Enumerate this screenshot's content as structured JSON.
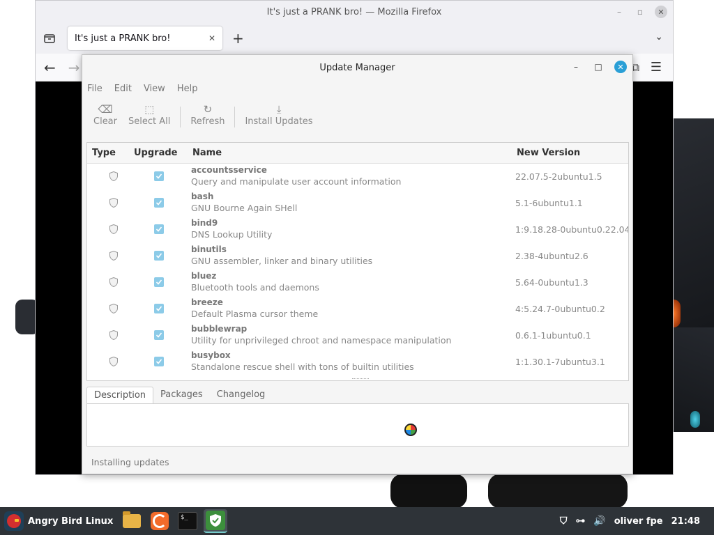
{
  "firefox": {
    "window_title": "It's just a PRANK bro! — Mozilla Firefox",
    "tab_title": "It's just a PRANK bro!",
    "tab_close": "✕",
    "new_tab": "+",
    "all_tabs": "⌄"
  },
  "update_manager": {
    "title": "Update Manager",
    "menu": [
      "File",
      "Edit",
      "View",
      "Help"
    ],
    "toolbar": {
      "clear": "Clear",
      "select_all": "Select All",
      "refresh": "Refresh",
      "install": "Install Updates"
    },
    "columns": {
      "type": "Type",
      "upgrade": "Upgrade",
      "name": "Name",
      "version": "New Version"
    },
    "packages": [
      {
        "name": "accountsservice",
        "desc": "Query and manipulate user account information",
        "version": "22.07.5-2ubuntu1.5",
        "checked": true
      },
      {
        "name": "bash",
        "desc": "GNU Bourne Again SHell",
        "version": "5.1-6ubuntu1.1",
        "checked": true
      },
      {
        "name": "bind9",
        "desc": "DNS Lookup Utility",
        "version": "1:9.18.28-0ubuntu0.22.04",
        "checked": true
      },
      {
        "name": "binutils",
        "desc": "GNU assembler, linker and binary utilities",
        "version": "2.38-4ubuntu2.6",
        "checked": true
      },
      {
        "name": "bluez",
        "desc": "Bluetooth tools and daemons",
        "version": "5.64-0ubuntu1.3",
        "checked": true
      },
      {
        "name": "breeze",
        "desc": "Default Plasma cursor theme",
        "version": "4:5.24.7-0ubuntu0.2",
        "checked": true
      },
      {
        "name": "bubblewrap",
        "desc": "Utility for unprivileged chroot and namespace manipulation",
        "version": "0.6.1-1ubuntu0.1",
        "checked": true
      },
      {
        "name": "busybox",
        "desc": "Standalone rescue shell with tons of builtin utilities",
        "version": "1:1.30.1-7ubuntu3.1",
        "checked": true
      }
    ],
    "detail_tabs": [
      "Description",
      "Packages",
      "Changelog"
    ],
    "active_detail_tab": "Description",
    "status": "Installing updates"
  },
  "taskbar": {
    "menu_label": "Angry Bird Linux",
    "user": "oliver fpe",
    "clock": "21:48"
  }
}
